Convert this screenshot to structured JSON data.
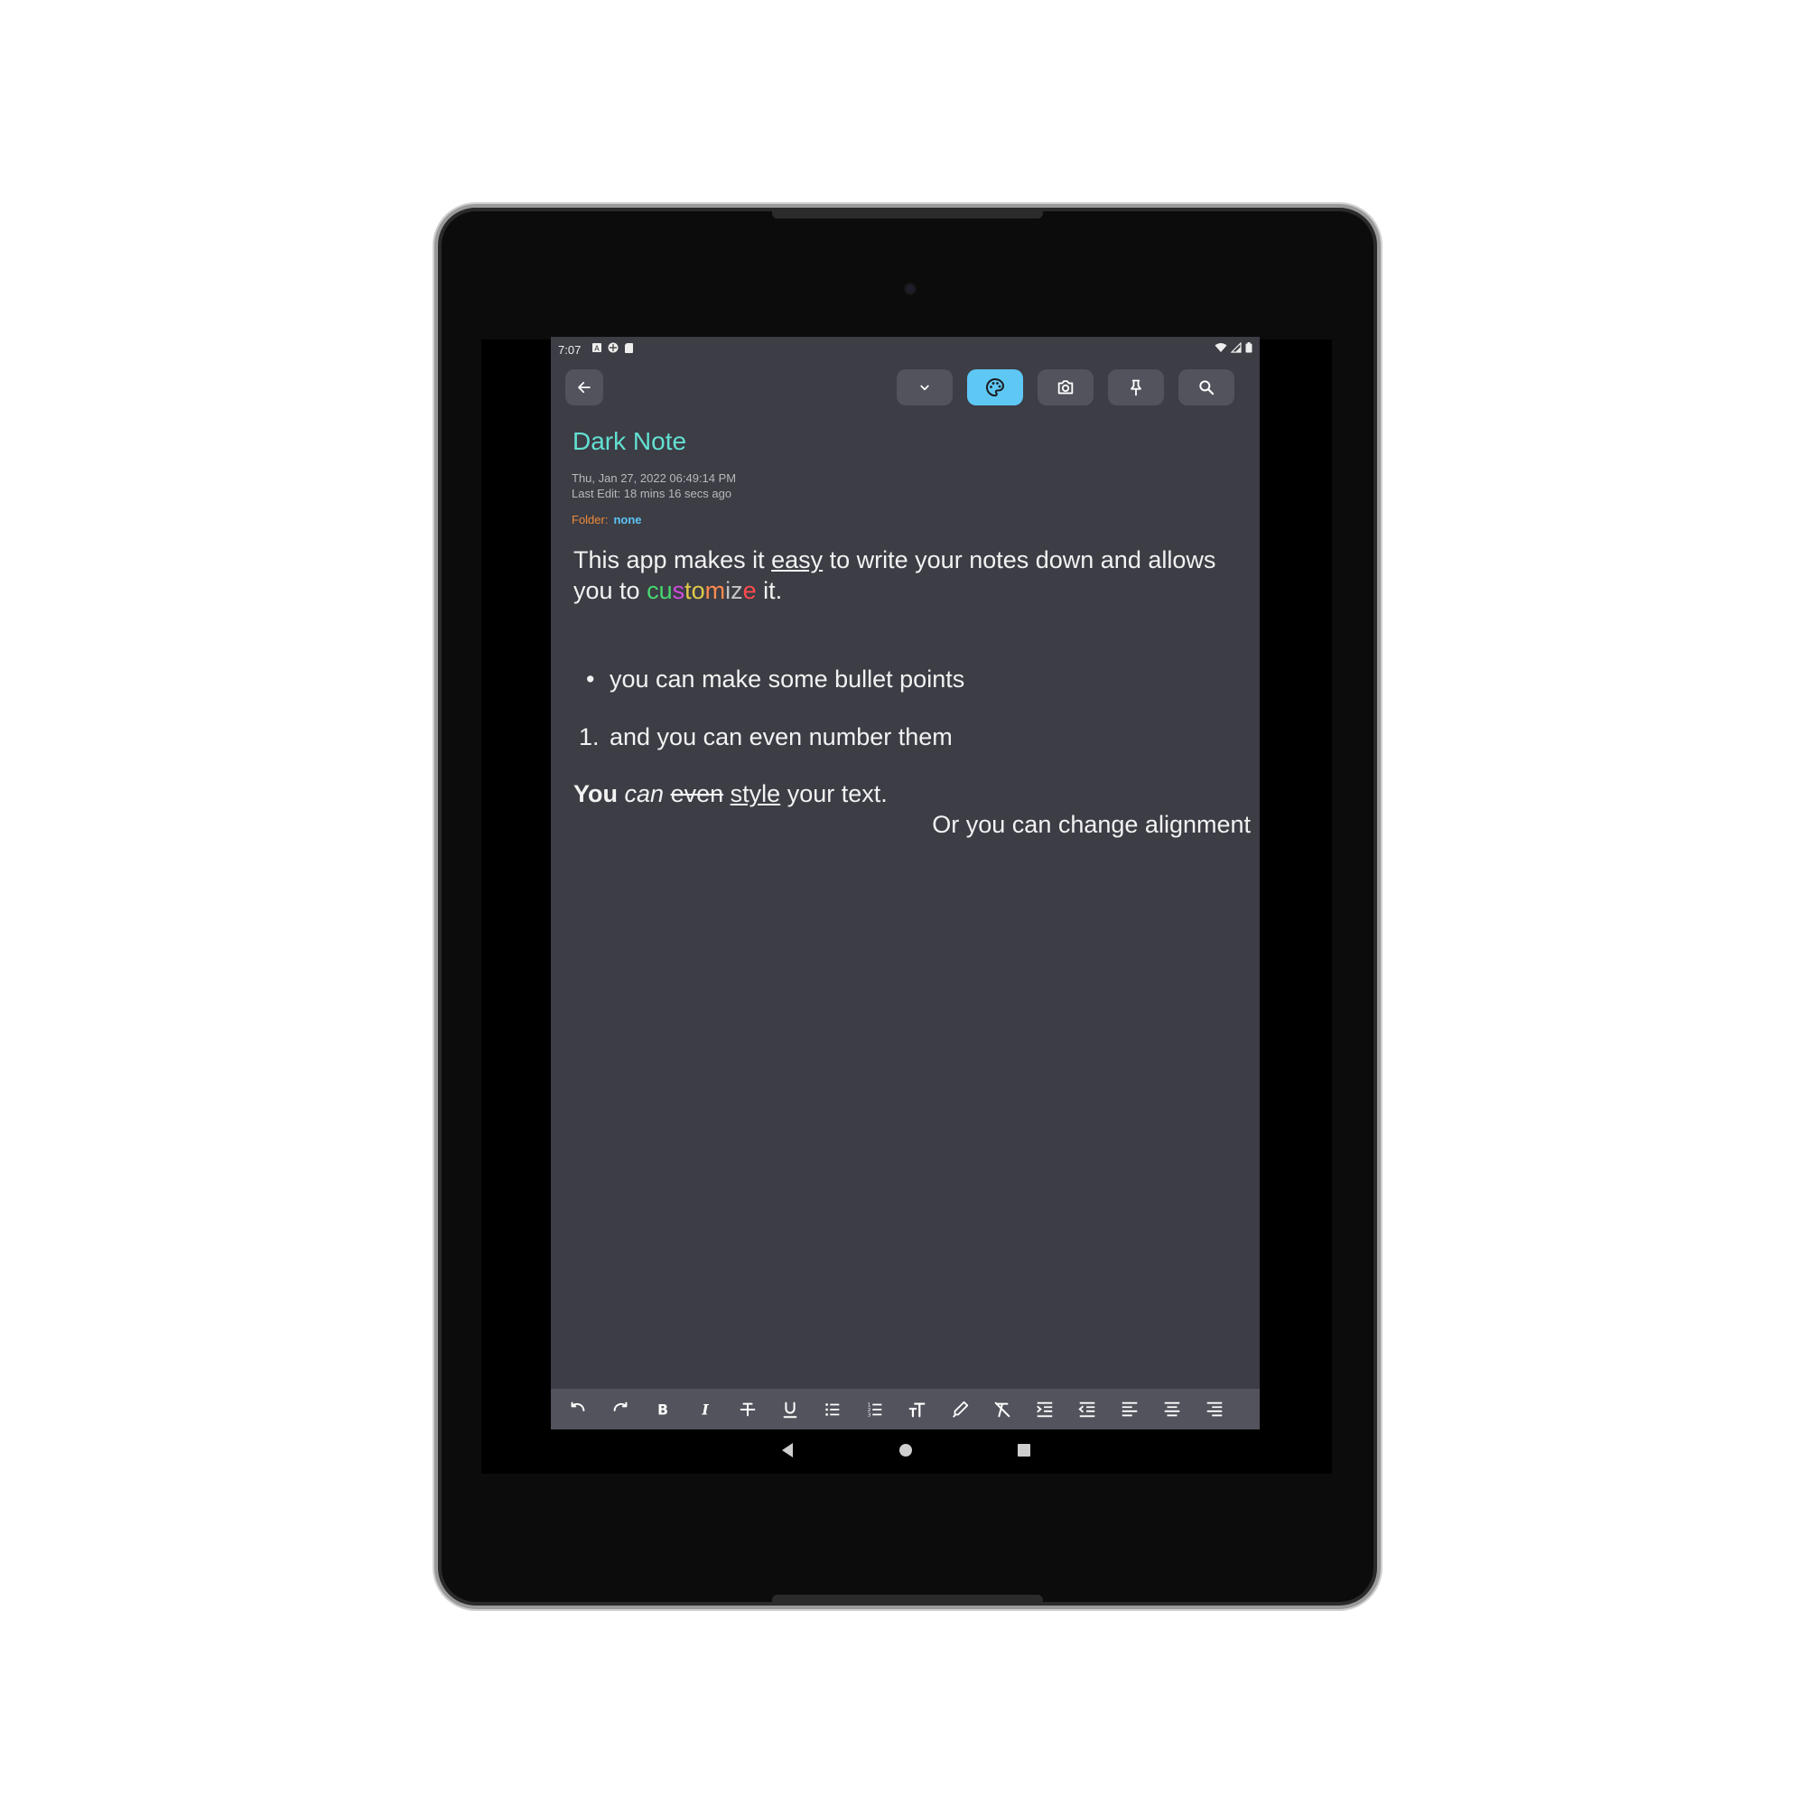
{
  "status_bar": {
    "time": "7:07"
  },
  "note": {
    "title": "Dark Note",
    "created": "Thu, Jan 27, 2022 06:49:14 PM",
    "last_edit": "Last Edit: 18 mins 16 secs ago",
    "folder_label": "Folder:",
    "folder_value": "none"
  },
  "body": {
    "p1_a": "This app makes it ",
    "p1_easy": "easy",
    "p1_b": " to write your notes down and allows you to ",
    "p1_customize_letters": [
      "c",
      "u",
      "s",
      "t",
      "o",
      "m",
      "i",
      "z",
      "e"
    ],
    "p1_customize_colors": [
      "#48d66f",
      "#48d66f",
      "#d24be0",
      "#e0c94a",
      "#e0c94a",
      "#ff8a50",
      "#c5c5c5",
      "#c5c5c5",
      "#ff4b4b"
    ],
    "p1_c": " it.",
    "bullet": "you can make some bullet points",
    "numbered_marker": "1.",
    "numbered": "and you can even number them",
    "style_bold": "You",
    "style_italic": "can",
    "style_strike": "even",
    "style_underline": "style",
    "style_rest": " your text.",
    "aligned": "Or you can change alignment"
  },
  "colors": {
    "background": "#3c3d45",
    "title": "#63e0d2",
    "accent": "#5fc7f4",
    "folder_label": "#f08a3a",
    "folder_value": "#5ec4f5"
  },
  "toolbar_icons": [
    "back-arrow-icon",
    "chevron-down-icon",
    "palette-icon",
    "camera-icon",
    "pin-icon",
    "search-icon"
  ],
  "format_icons": [
    "undo-icon",
    "redo-icon",
    "bold-icon",
    "italic-icon",
    "strikethrough-icon",
    "underline-icon",
    "bullet-list-icon",
    "numbered-list-icon",
    "text-size-icon",
    "text-color-icon",
    "clear-format-icon",
    "indent-icon",
    "outdent-icon",
    "align-left-icon",
    "align-center-icon",
    "align-right-icon"
  ]
}
